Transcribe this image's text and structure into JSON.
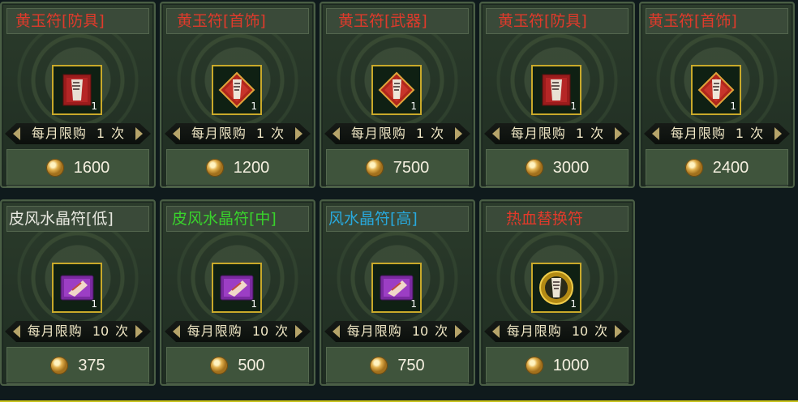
{
  "colors": {
    "red_title": "#e03a2b",
    "white_title": "#e8e8e0",
    "green_title": "#39d32c",
    "blue_title": "#28a9dd"
  },
  "shop": {
    "items": [
      {
        "title": "黄玉符[防具]",
        "title_color": "#e03a2b",
        "icon": "red-talisman-card",
        "qty": "1",
        "limit_label": "每月限购",
        "limit_num": "1",
        "limit_unit": "次",
        "price": "1600"
      },
      {
        "title": "黄玉符[首饰]",
        "title_color": "#e03a2b",
        "icon": "red-diamond-talisman",
        "qty": "1",
        "limit_label": "每月限购",
        "limit_num": "1",
        "limit_unit": "次",
        "price": "1200"
      },
      {
        "title": "黄玉符[武器]",
        "title_color": "#e03a2b",
        "icon": "red-diamond-talisman",
        "qty": "1",
        "limit_label": "每月限购",
        "limit_num": "1",
        "limit_unit": "次",
        "price": "7500"
      },
      {
        "title": "黄玉符[防具]",
        "title_color": "#e03a2b",
        "icon": "red-talisman-card",
        "qty": "1",
        "limit_label": "每月限购",
        "limit_num": "1",
        "limit_unit": "次",
        "price": "3000"
      },
      {
        "title": "黄玉符[首饰]",
        "title_color": "#e03a2b",
        "icon": "red-diamond-talisman",
        "qty": "1",
        "limit_label": "每月限购",
        "limit_num": "1",
        "limit_unit": "次",
        "price": "2400"
      },
      {
        "title": "皮风水晶符[低]",
        "title_color": "#e8e8e0",
        "icon": "purple-crystal-talisman",
        "qty": "1",
        "limit_label": "每月限购",
        "limit_num": "10",
        "limit_unit": "次",
        "price": "375"
      },
      {
        "title": "皮风水晶符[中]",
        "title_color": "#39d32c",
        "icon": "purple-crystal-talisman",
        "qty": "1",
        "limit_label": "每月限购",
        "limit_num": "10",
        "limit_unit": "次",
        "price": "500"
      },
      {
        "title": "风水晶符[高]",
        "title_color": "#28a9dd",
        "icon": "purple-crystal-talisman",
        "qty": "1",
        "limit_label": "每月限购",
        "limit_num": "10",
        "limit_unit": "次",
        "price": "750"
      },
      {
        "title": "热血替换符",
        "title_color": "#e03a2b",
        "icon": "gold-round-talisman",
        "qty": "1",
        "limit_label": "每月限购",
        "limit_num": "10",
        "limit_unit": "次",
        "price": "1000"
      }
    ]
  }
}
